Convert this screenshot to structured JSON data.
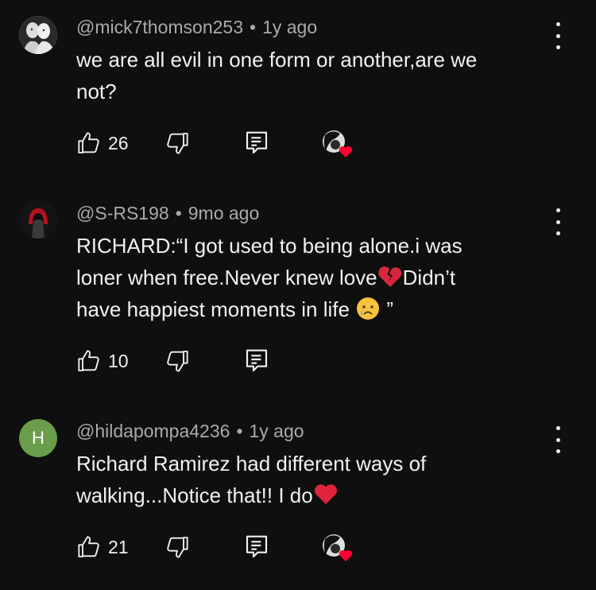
{
  "comments": [
    {
      "handle": "@mick7thomson253",
      "time": "1y ago",
      "text_lines": [
        "we are all evil in one form or another,are we",
        "not?"
      ],
      "likes": "26",
      "avatar_icon": "bw-photo-avatar",
      "creator_heart": true
    },
    {
      "handle": "@S-RS198",
      "time": "9mo ago",
      "text": {
        "l1": "RICHARD:“I got used to being alone.i was",
        "l2a": "loner when free.Never knew love",
        "l2b": "Didn’t",
        "l3a": "have happiest moments in life ",
        "l3b": " ”"
      },
      "likes": "10",
      "avatar_icon": "dark-red-hooded-avatar",
      "creator_heart": false
    },
    {
      "handle": "@hildapompa4236",
      "time": "1y ago",
      "avatar_letter": "H",
      "avatar_color": "#6a9e4a",
      "text_lines": [
        "Richard Ramirez had  different ways of",
        "walking...Notice that!! I do"
      ],
      "likes": "21",
      "creator_heart": true
    }
  ],
  "dot_separator": "•",
  "colors": {
    "background": "#0f0f0f",
    "text": "#f1f1f1",
    "meta": "#aaaaaa",
    "heart": "#ff0033"
  }
}
